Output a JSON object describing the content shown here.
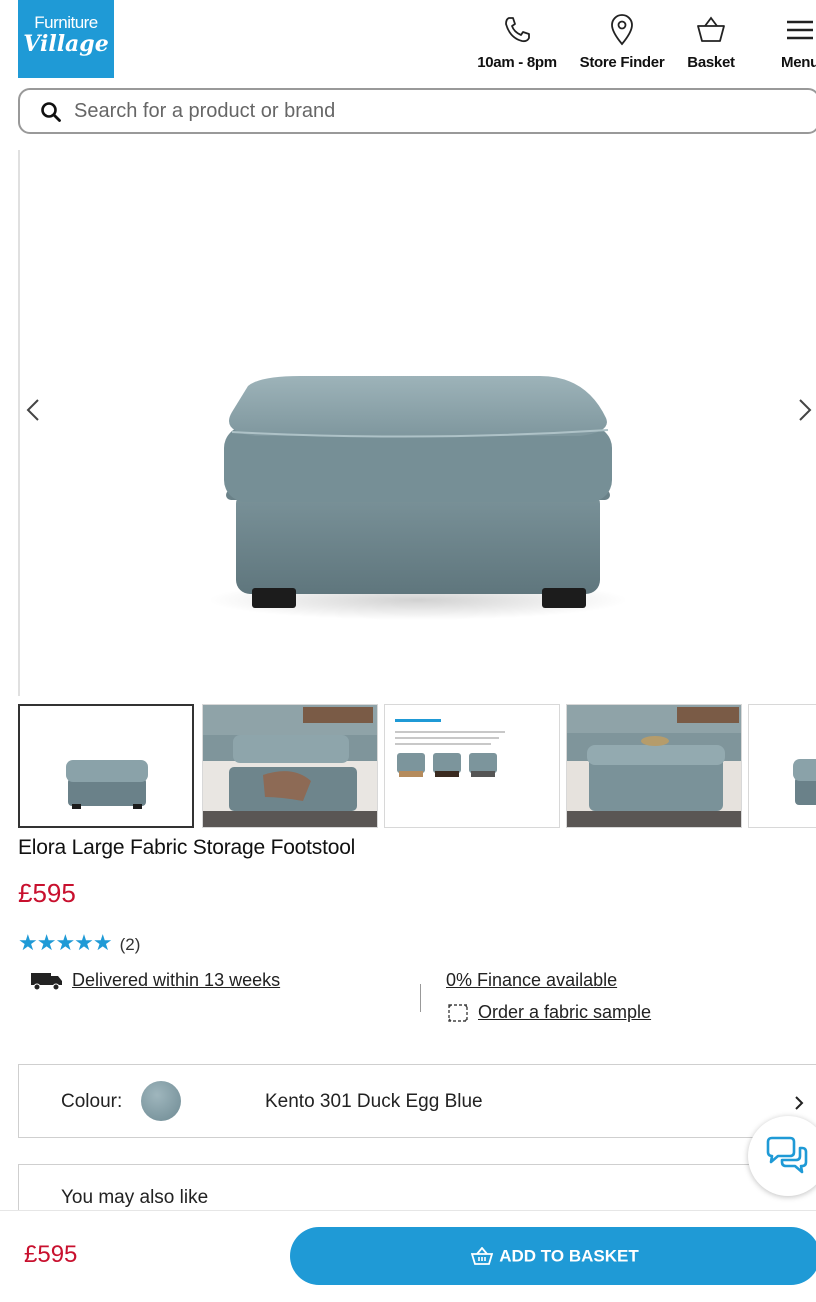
{
  "brand": {
    "line1": "Furniture",
    "line2": "Village"
  },
  "header": {
    "hours": "10am - 8pm",
    "store_finder": "Store Finder",
    "basket": "Basket",
    "menu": "Menu"
  },
  "search": {
    "placeholder": "Search for a product or brand"
  },
  "product": {
    "title": "Elora Large Fabric Storage Footstool",
    "price": "£595",
    "rating": 5,
    "stars": "★★★★★",
    "review_count": "(2)",
    "delivery": "Delivered within 13 weeks",
    "finance": "0% Finance available",
    "sample": "Order a fabric sample"
  },
  "colour": {
    "label": "Colour:",
    "value": "Kento 301 Duck Egg Blue"
  },
  "also_like": {
    "label": "You may also like"
  },
  "bottom_bar": {
    "price": "£595",
    "add_label": "ADD TO BASKET"
  },
  "thumbnails": [
    {
      "name": "thumbnail-1"
    },
    {
      "name": "thumbnail-2"
    },
    {
      "name": "thumbnail-3"
    },
    {
      "name": "thumbnail-4"
    },
    {
      "name": "thumbnail-5"
    }
  ],
  "colors": {
    "brand": "#1f9ad6",
    "price": "#c8102e",
    "fabric": "#7c959c"
  }
}
